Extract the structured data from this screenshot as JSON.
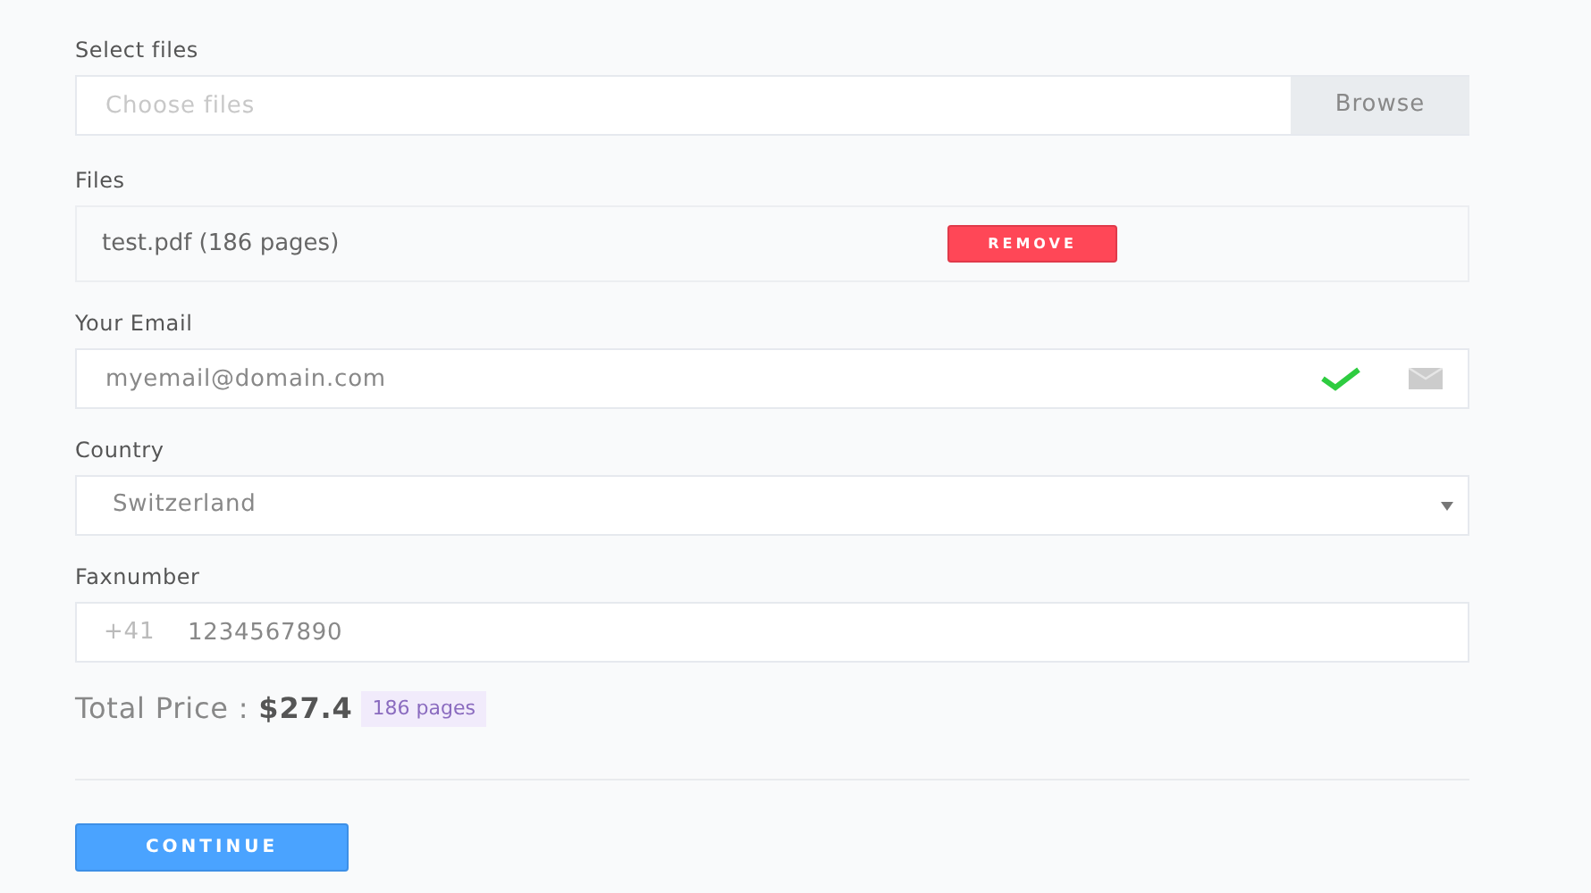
{
  "select_files": {
    "label": "Select files",
    "placeholder": "Choose files",
    "button": "Browse"
  },
  "files": {
    "label": "Files",
    "items": [
      {
        "name": "test.pdf (186 pages)",
        "button": "REMOVE"
      }
    ]
  },
  "email": {
    "label": "Your Email",
    "value": "myemail@domain.com",
    "valid": true
  },
  "country": {
    "label": "Country",
    "value": "Switzerland"
  },
  "fax": {
    "label": "Faxnumber",
    "prefix": "+41",
    "value": "1234567890"
  },
  "total": {
    "text": "Total Price : **$27.4**",
    "badge": "186 pages"
  },
  "continue_button": "CONTINUE"
}
